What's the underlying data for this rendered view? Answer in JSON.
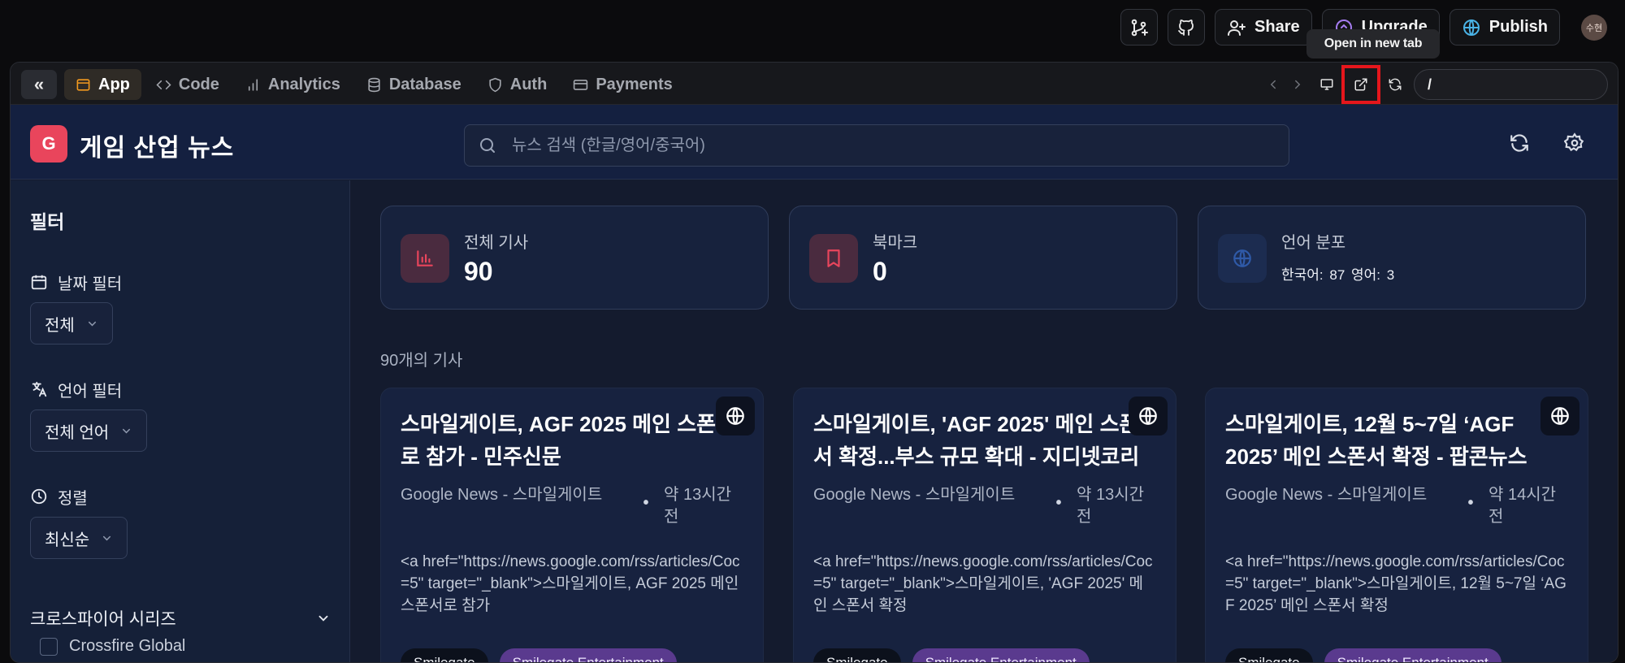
{
  "topbar": {
    "share_label": "Share",
    "upgrade_label": "Upgrade",
    "publish_label": "Publish",
    "avatar_text": "수현",
    "tooltip": "Open in new tab"
  },
  "frame": {
    "collapse_label": "«",
    "tabs": [
      {
        "label": "App",
        "icon": "window-icon"
      },
      {
        "label": "Code",
        "icon": "code-icon"
      },
      {
        "label": "Analytics",
        "icon": "bar-chart-icon"
      },
      {
        "label": "Database",
        "icon": "database-icon"
      },
      {
        "label": "Auth",
        "icon": "shield-icon"
      },
      {
        "label": "Payments",
        "icon": "card-icon"
      }
    ],
    "url_value": "/"
  },
  "app": {
    "logo_letter": "G",
    "title": "게임 산업 뉴스",
    "search_placeholder": "뉴스 검색 (한글/영어/중국어)"
  },
  "sidebar": {
    "title": "필터",
    "date_label": "날짜 필터",
    "date_value": "전체",
    "lang_label": "언어 필터",
    "lang_value": "전체 언어",
    "sort_label": "정렬",
    "sort_value": "최신순",
    "series_label": "크로스파이어 시리즈",
    "series_item": "Crossfire Global"
  },
  "stats": [
    {
      "label": "전체 기사",
      "value": "90",
      "color": "#e9455c"
    },
    {
      "label": "북마크",
      "value": "0",
      "color": "#e9455c"
    },
    {
      "label": "언어 분포",
      "sub": "한국어: 87  영어: 3",
      "color": "#2f5aa8"
    }
  ],
  "article_count": "90개의 기사",
  "cards": [
    {
      "title": "스마일게이트, AGF 2025 메인 스폰서로 참가 - 민주신문",
      "source": "Google News - 스마일게이트",
      "time": "약 13시간 전",
      "body": "<a href=\"https://news.google.com/rss/articles/Coc=5\" target=\"_blank\">스마일게이트, AGF 2025 메인 스폰서로 참가",
      "tags": [
        "Smilegate",
        "Smilegate Entertainment"
      ]
    },
    {
      "title": "스마일게이트, 'AGF 2025' 메인 스폰서 확정...부스 규모 확대 - 지디넷코리아",
      "source": "Google News - 스마일게이트",
      "time": "약 13시간 전",
      "body": "<a href=\"https://news.google.com/rss/articles/Coc=5\" target=\"_blank\">스마일게이트, 'AGF 2025' 메인 스폰서 확정",
      "tags": [
        "Smilegate",
        "Smilegate Entertainment"
      ]
    },
    {
      "title": "스마일게이트, 12월 5~7일 ‘AGF 2025’ 메인 스폰서 확정 - 팝콘뉴스",
      "source": "Google News - 스마일게이트",
      "time": "약 14시간 전",
      "body": "<a href=\"https://news.google.com/rss/articles/Coc=5\" target=\"_blank\">스마일게이트, 12월 5~7일 ‘AGF 2025’ 메인 스폰서 확정",
      "tags": [
        "Smilegate",
        "Smilegate Entertainment"
      ]
    }
  ]
}
